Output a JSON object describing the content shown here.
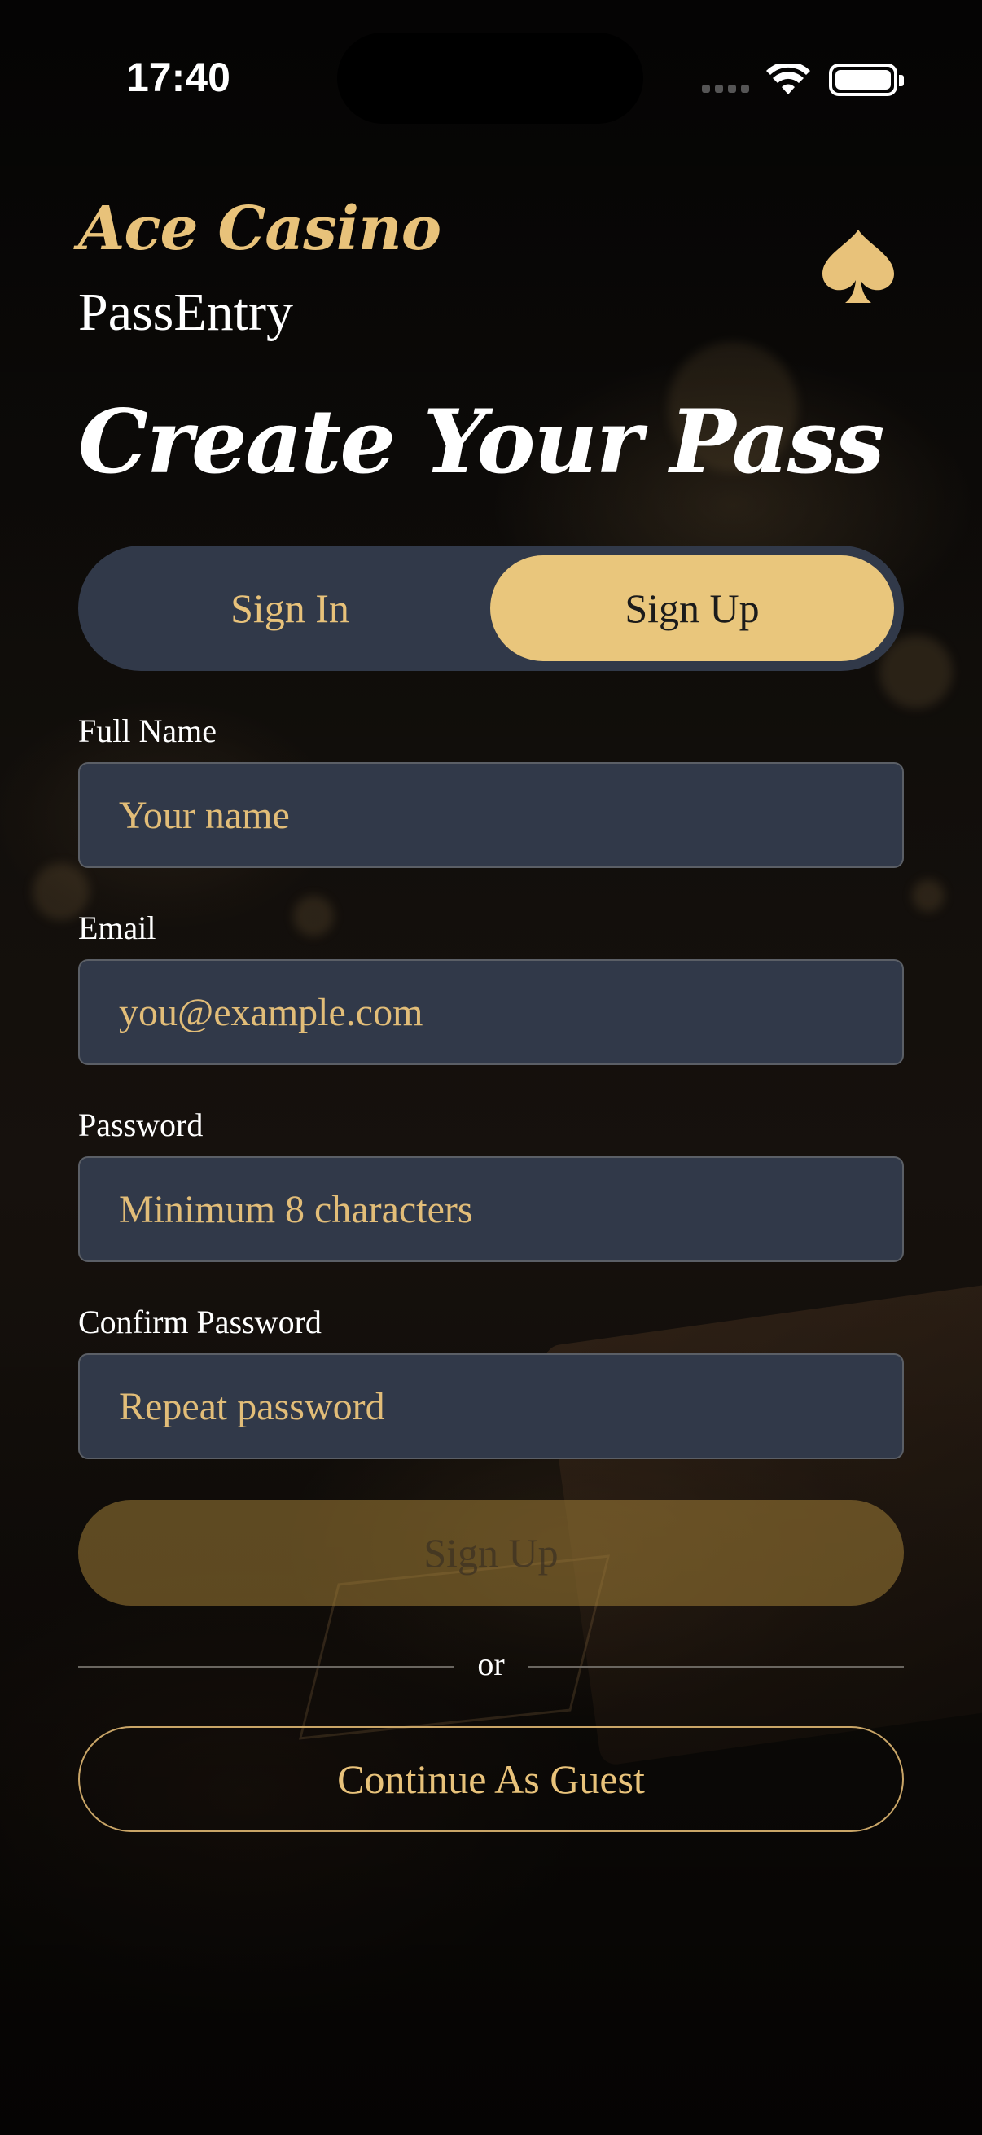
{
  "status_bar": {
    "time": "17:40"
  },
  "header": {
    "brand": "Ace Casino",
    "subtitle": "PassEntry",
    "logo_icon": "spade-icon"
  },
  "page": {
    "title": "Create Your Pass"
  },
  "auth_tabs": {
    "items": [
      {
        "label": "Sign In",
        "selected": false
      },
      {
        "label": "Sign Up",
        "selected": true
      }
    ]
  },
  "form": {
    "full_name": {
      "label": "Full Name",
      "placeholder": "Your name",
      "value": ""
    },
    "email": {
      "label": "Email",
      "placeholder": "you@example.com",
      "value": ""
    },
    "password": {
      "label": "Password",
      "placeholder": "Minimum 8 characters",
      "value": ""
    },
    "confirm_password": {
      "label": "Confirm Password",
      "placeholder": "Repeat password",
      "value": ""
    },
    "submit_label": "Sign Up",
    "divider_text": "or",
    "guest_label": "Continue As Guest"
  },
  "colors": {
    "accent_gold": "#e9c67c",
    "field_background": "#313949",
    "background": "#0c0a08"
  }
}
